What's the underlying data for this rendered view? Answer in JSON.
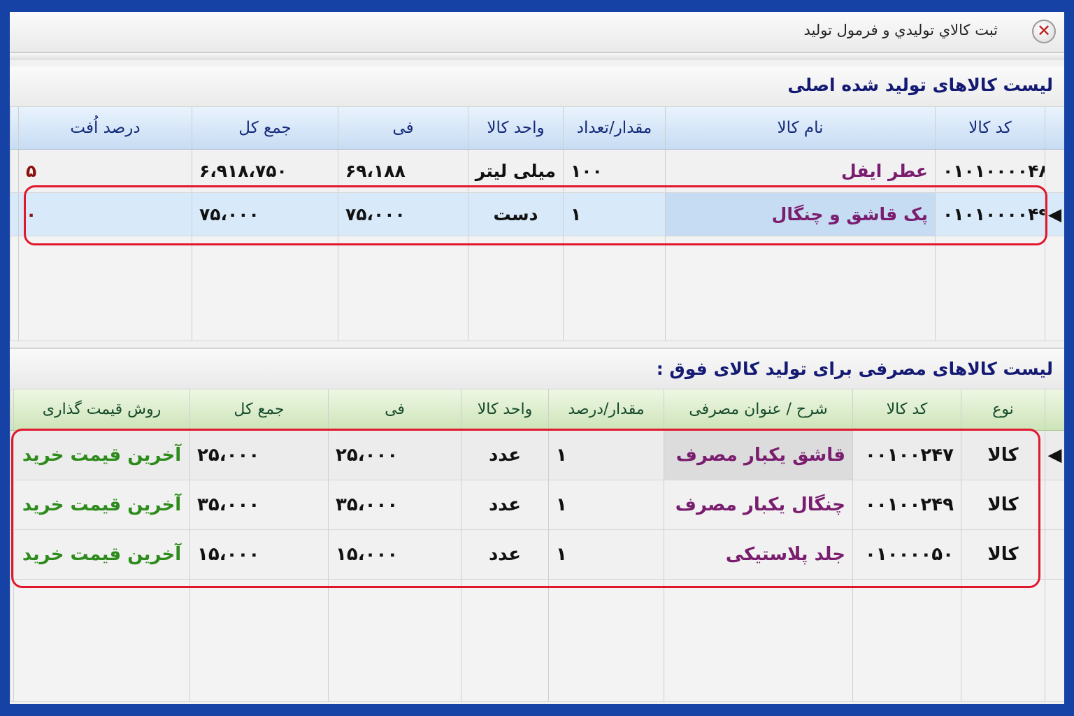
{
  "window": {
    "title": "ثبت کالاي توليدي و فرمول توليد",
    "close_glyph": "✕"
  },
  "section1": {
    "title": "لیست کالاهای تولید شده اصلی",
    "columns": [
      "کد کالا",
      "نام کالا",
      "مقدار/تعداد",
      "واحد کالا",
      "فی",
      "جمع کل",
      "درصد اُفت"
    ],
    "rows": [
      {
        "code": "۰۱۰۱۰۰۰۰۴۸",
        "name": "عطر ایفل",
        "qty": "۱۰۰",
        "unit": "میلی لیتر",
        "fee": "۶۹،۱۸۸",
        "total": "۶،۹۱۸،۷۵۰",
        "loss": "۵"
      },
      {
        "code": "۰۱۰۱۰۰۰۰۴۹",
        "name": "پک قاشق و چنگال",
        "qty": "۱",
        "unit": "دست",
        "fee": "۷۵،۰۰۰",
        "total": "۷۵،۰۰۰",
        "loss": "۰"
      }
    ],
    "selected_indicator": "◀"
  },
  "section2": {
    "title": "لیست کالاهای مصرفی برای تولید کالای فوق :",
    "columns": [
      "نوع",
      "کد کالا",
      "شرح / عنوان مصرفی",
      "مقدار/درصد",
      "واحد کالا",
      "فی",
      "جمع کل",
      "روش قیمت گذاری"
    ],
    "rows": [
      {
        "type": "کالا",
        "code": "۰۰۱۰۰۲۴۷",
        "name": "قاشق یکبار مصرف",
        "qty": "۱",
        "unit": "عدد",
        "fee": "۲۵،۰۰۰",
        "total": "۲۵،۰۰۰",
        "method": "آخرین قیمت خرید"
      },
      {
        "type": "کالا",
        "code": "۰۰۱۰۰۲۴۹",
        "name": "چنگال یکبار مصرف",
        "qty": "۱",
        "unit": "عدد",
        "fee": "۳۵،۰۰۰",
        "total": "۳۵،۰۰۰",
        "method": "آخرین قیمت خرید"
      },
      {
        "type": "کالا",
        "code": "۰۱۰۰۰۰۵۰",
        "name": "جلد پلاستیکی",
        "qty": "۱",
        "unit": "عدد",
        "fee": "۱۵،۰۰۰",
        "total": "۱۵،۰۰۰",
        "method": "آخرین قیمت خرید"
      }
    ],
    "selected_indicator": "◀"
  },
  "colors": {
    "frame": "#1641a5",
    "highlight": "#e0172d",
    "name_text": "#7a1d6f",
    "method_text": "#2c8b1a"
  }
}
